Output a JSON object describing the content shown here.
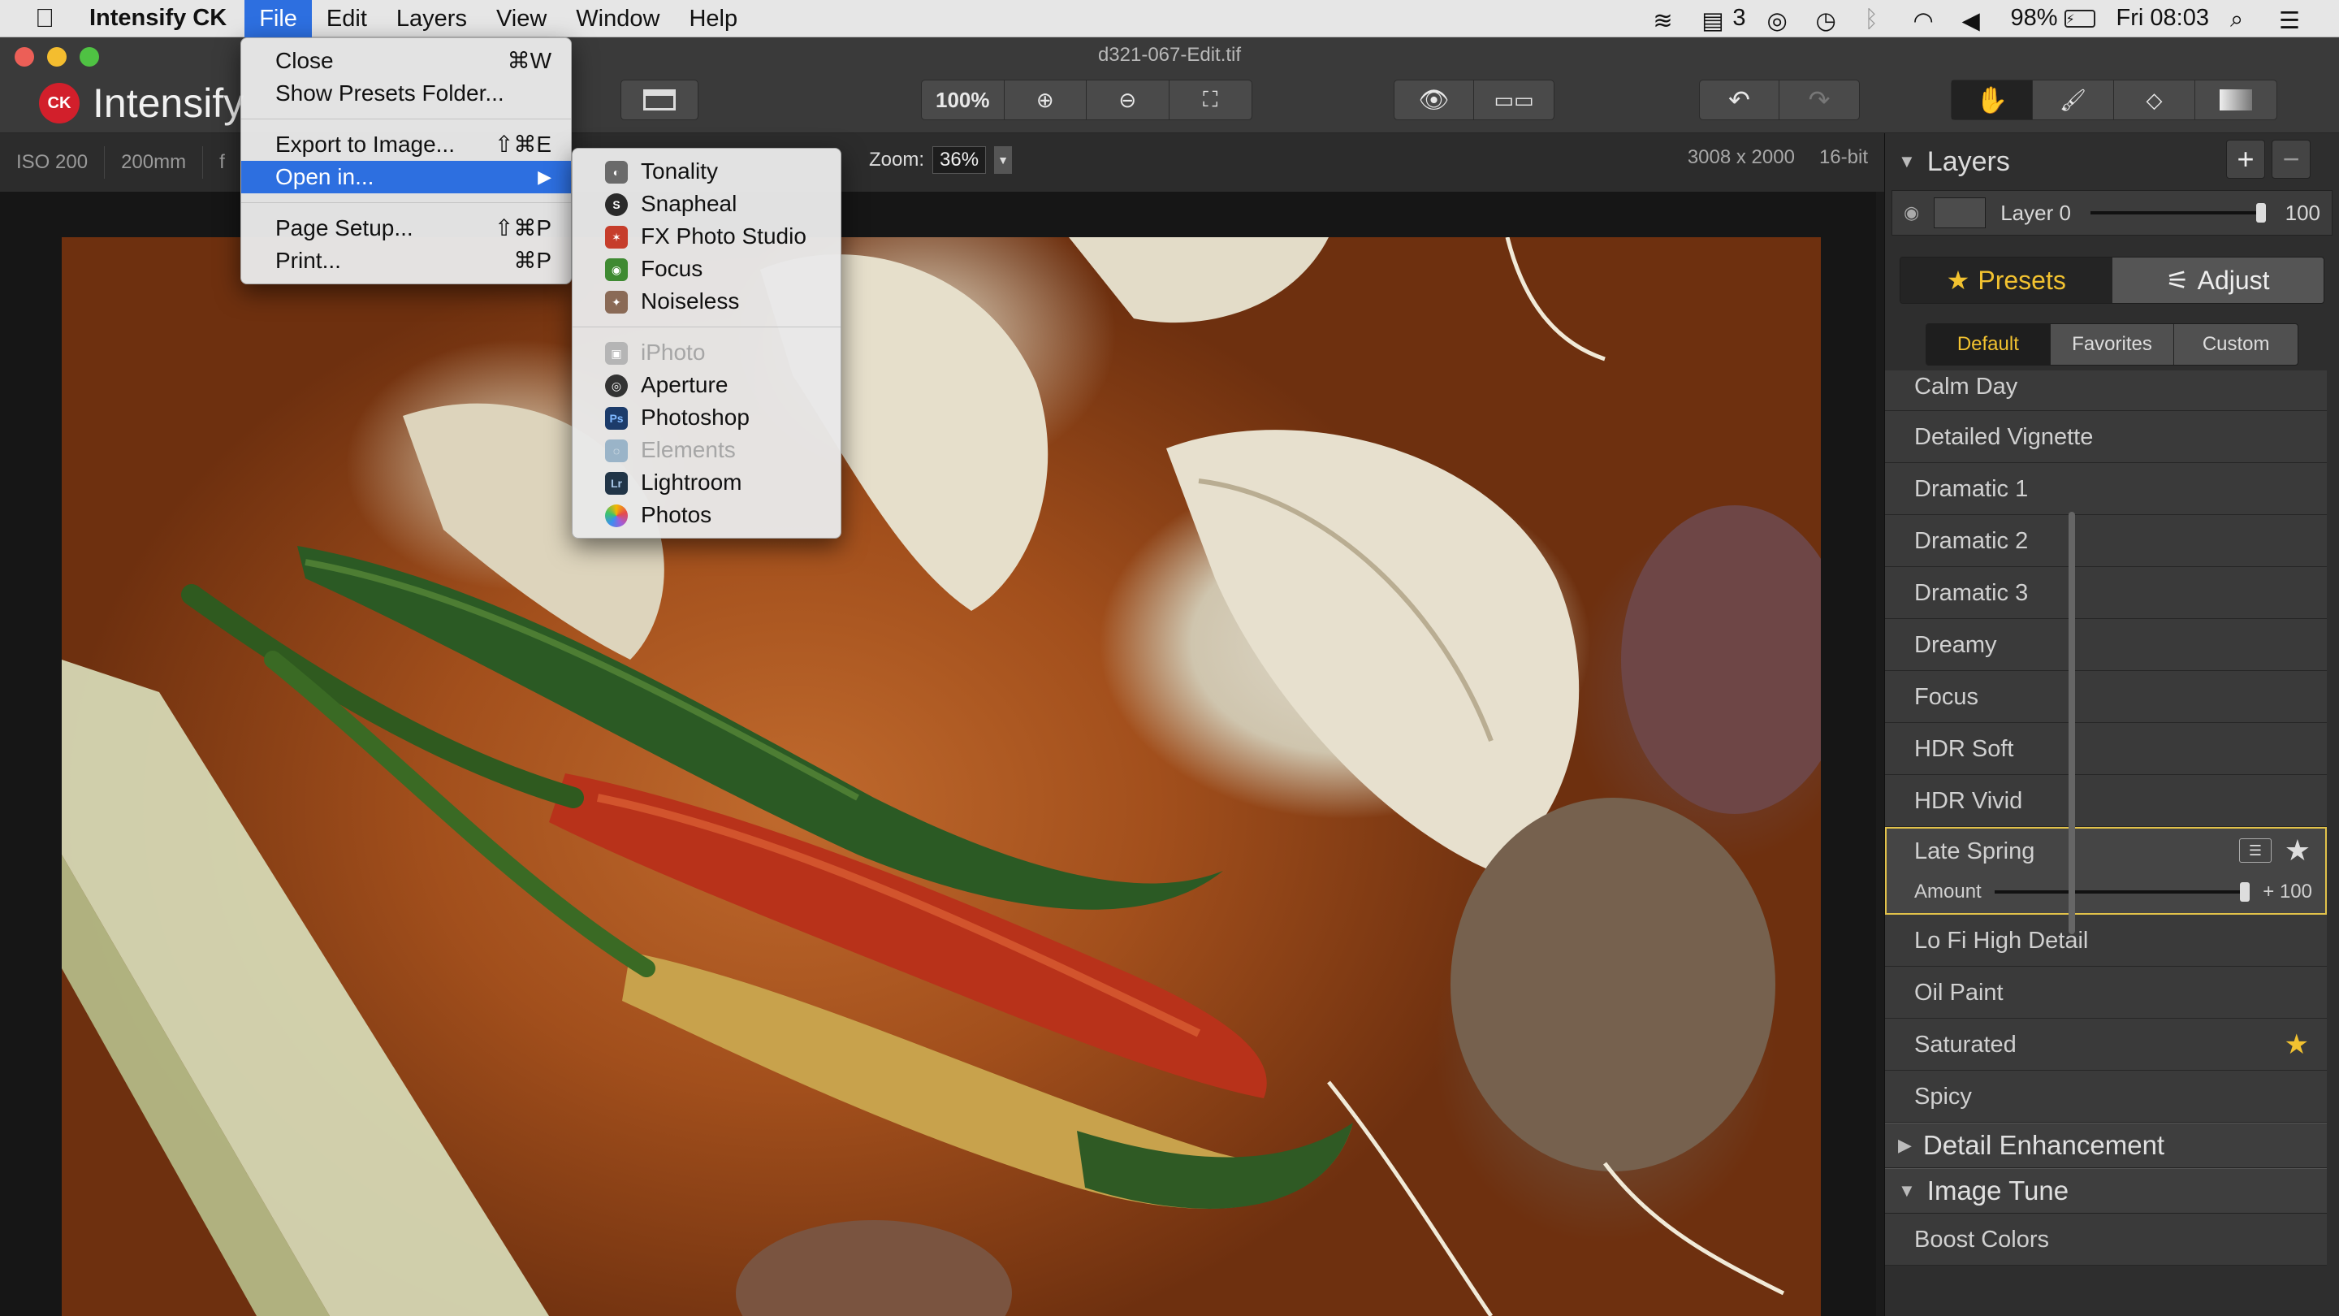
{
  "menubar": {
    "app_name": "Intensify CK",
    "menus": [
      "File",
      "Edit",
      "Layers",
      "View",
      "Window",
      "Help"
    ],
    "status": {
      "notifications_count": "3",
      "battery": "98%",
      "clock": "Fri 08:03"
    }
  },
  "window": {
    "doc_title": "d321-067-Edit.tif",
    "brand": "Intensify",
    "brand_badge": "CK",
    "zoom_button": "100%"
  },
  "info": {
    "iso": "ISO 200",
    "focal": "200mm",
    "aperture_partial": "f",
    "zoom_label": "Zoom:",
    "zoom_value": "36%",
    "dimensions": "3008 x 2000",
    "bit_depth": "16-bit"
  },
  "file_menu": {
    "close": "Close",
    "close_sc": "⌘W",
    "show_presets": "Show Presets Folder...",
    "export": "Export to Image...",
    "export_sc": "⇧⌘E",
    "open_in": "Open in...",
    "page_setup": "Page Setup...",
    "page_setup_sc": "⇧⌘P",
    "print": "Print...",
    "print_sc": "⌘P"
  },
  "open_in_menu": {
    "apps": [
      "Tonality",
      "Snapheal",
      "FX Photo Studio",
      "Focus",
      "Noiseless"
    ],
    "hosts": [
      "iPhoto",
      "Aperture",
      "Photoshop",
      "Elements",
      "Lightroom",
      "Photos"
    ]
  },
  "layers": {
    "title": "Layers",
    "layer_name": "Layer 0",
    "opacity": "100",
    "opacity_fraction": 1.0
  },
  "tabs": {
    "presets": "Presets",
    "adjust": "Adjust"
  },
  "subtabs": {
    "default": "Default",
    "favorites": "Favorites",
    "custom": "Custom"
  },
  "presets": {
    "before": [
      "Calm Day",
      "Detailed Vignette",
      "Dramatic 1",
      "Dramatic 2",
      "Dramatic 3",
      "Dreamy",
      "Focus",
      "HDR Soft",
      "HDR Vivid"
    ],
    "selected": {
      "name": "Late Spring",
      "amount_label": "Amount",
      "amount_value": "+ 100"
    },
    "after": [
      "Lo Fi High Detail",
      "Oil Paint",
      "Saturated",
      "Spicy"
    ],
    "sections": [
      "Detail Enhancement",
      "Image Tune"
    ],
    "image_tune": [
      "Boost Colors"
    ]
  },
  "colors": {
    "accent_blue": "#2d6fe0",
    "accent_gold": "#f2c230",
    "brand_red": "#d21f2b"
  }
}
